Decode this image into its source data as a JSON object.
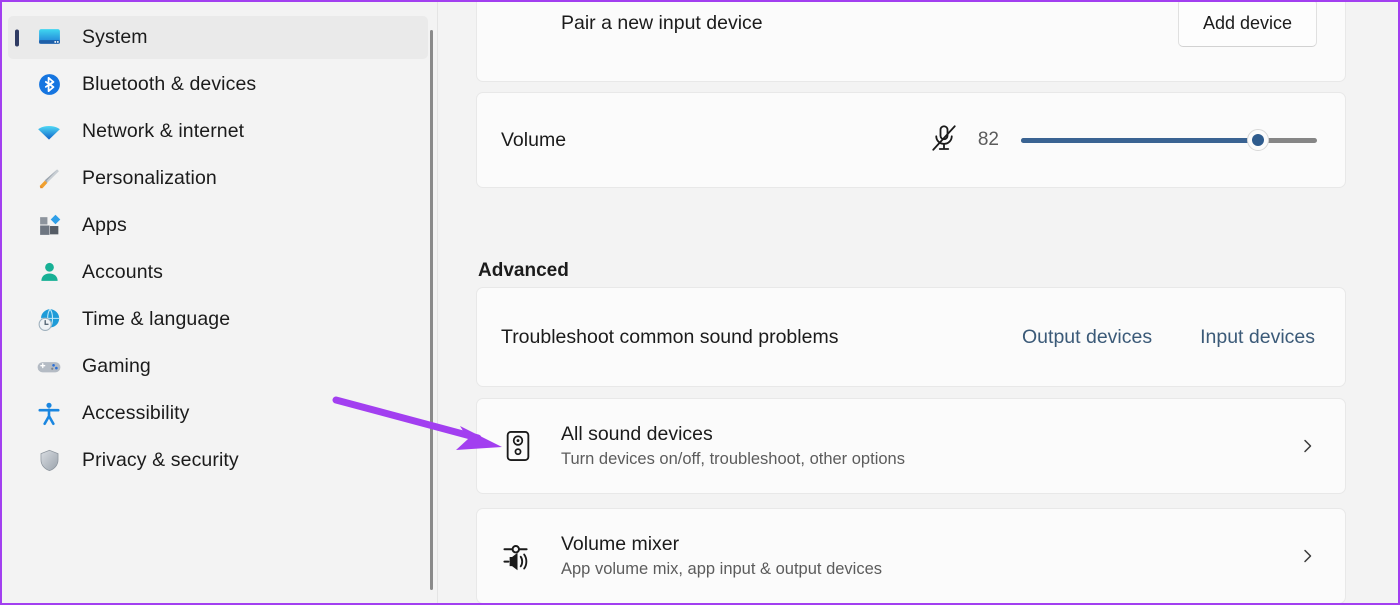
{
  "window": {
    "accent_purple": "#a23ff0",
    "pane_background": "#f3f3f3",
    "card_background": "#fbfbfb",
    "link_color": "#3b5a78",
    "slider_fill_color": "#3a6392"
  },
  "sidebar": {
    "items": [
      {
        "label": "System",
        "icon": "monitor-icon",
        "selected": true
      },
      {
        "label": "Bluetooth & devices",
        "icon": "bluetooth-icon",
        "selected": false
      },
      {
        "label": "Network & internet",
        "icon": "wifi-icon",
        "selected": false
      },
      {
        "label": "Personalization",
        "icon": "paintbrush-icon",
        "selected": false
      },
      {
        "label": "Apps",
        "icon": "apps-icon",
        "selected": false
      },
      {
        "label": "Accounts",
        "icon": "person-icon",
        "selected": false
      },
      {
        "label": "Time & language",
        "icon": "clock-globe-icon",
        "selected": false
      },
      {
        "label": "Gaming",
        "icon": "gamepad-icon",
        "selected": false
      },
      {
        "label": "Accessibility",
        "icon": "accessibility-icon",
        "selected": false
      },
      {
        "label": "Privacy & security",
        "icon": "shield-icon",
        "selected": false
      }
    ]
  },
  "content": {
    "pair_device": {
      "title": "Pair a new input device",
      "button_label": "Add device"
    },
    "volume": {
      "label": "Volume",
      "value": "82",
      "percent": 80,
      "mute_icon": "microphone-muted-icon"
    },
    "advanced": {
      "heading": "Advanced",
      "troubleshoot": {
        "title": "Troubleshoot common sound problems",
        "links": [
          {
            "label": "Output devices"
          },
          {
            "label": "Input devices"
          }
        ]
      },
      "rows": [
        {
          "title": "All sound devices",
          "subtitle": "Turn devices on/off, troubleshoot, other options",
          "icon": "speaker-box-icon",
          "chevron": "chevron-right-icon"
        },
        {
          "title": "Volume mixer",
          "subtitle": "App volume mix, app input & output devices",
          "icon": "volume-mixer-icon",
          "chevron": "chevron-right-icon"
        }
      ]
    }
  },
  "annotation": {
    "arrow_color": "#a23ff0",
    "points_to": "All sound devices"
  }
}
